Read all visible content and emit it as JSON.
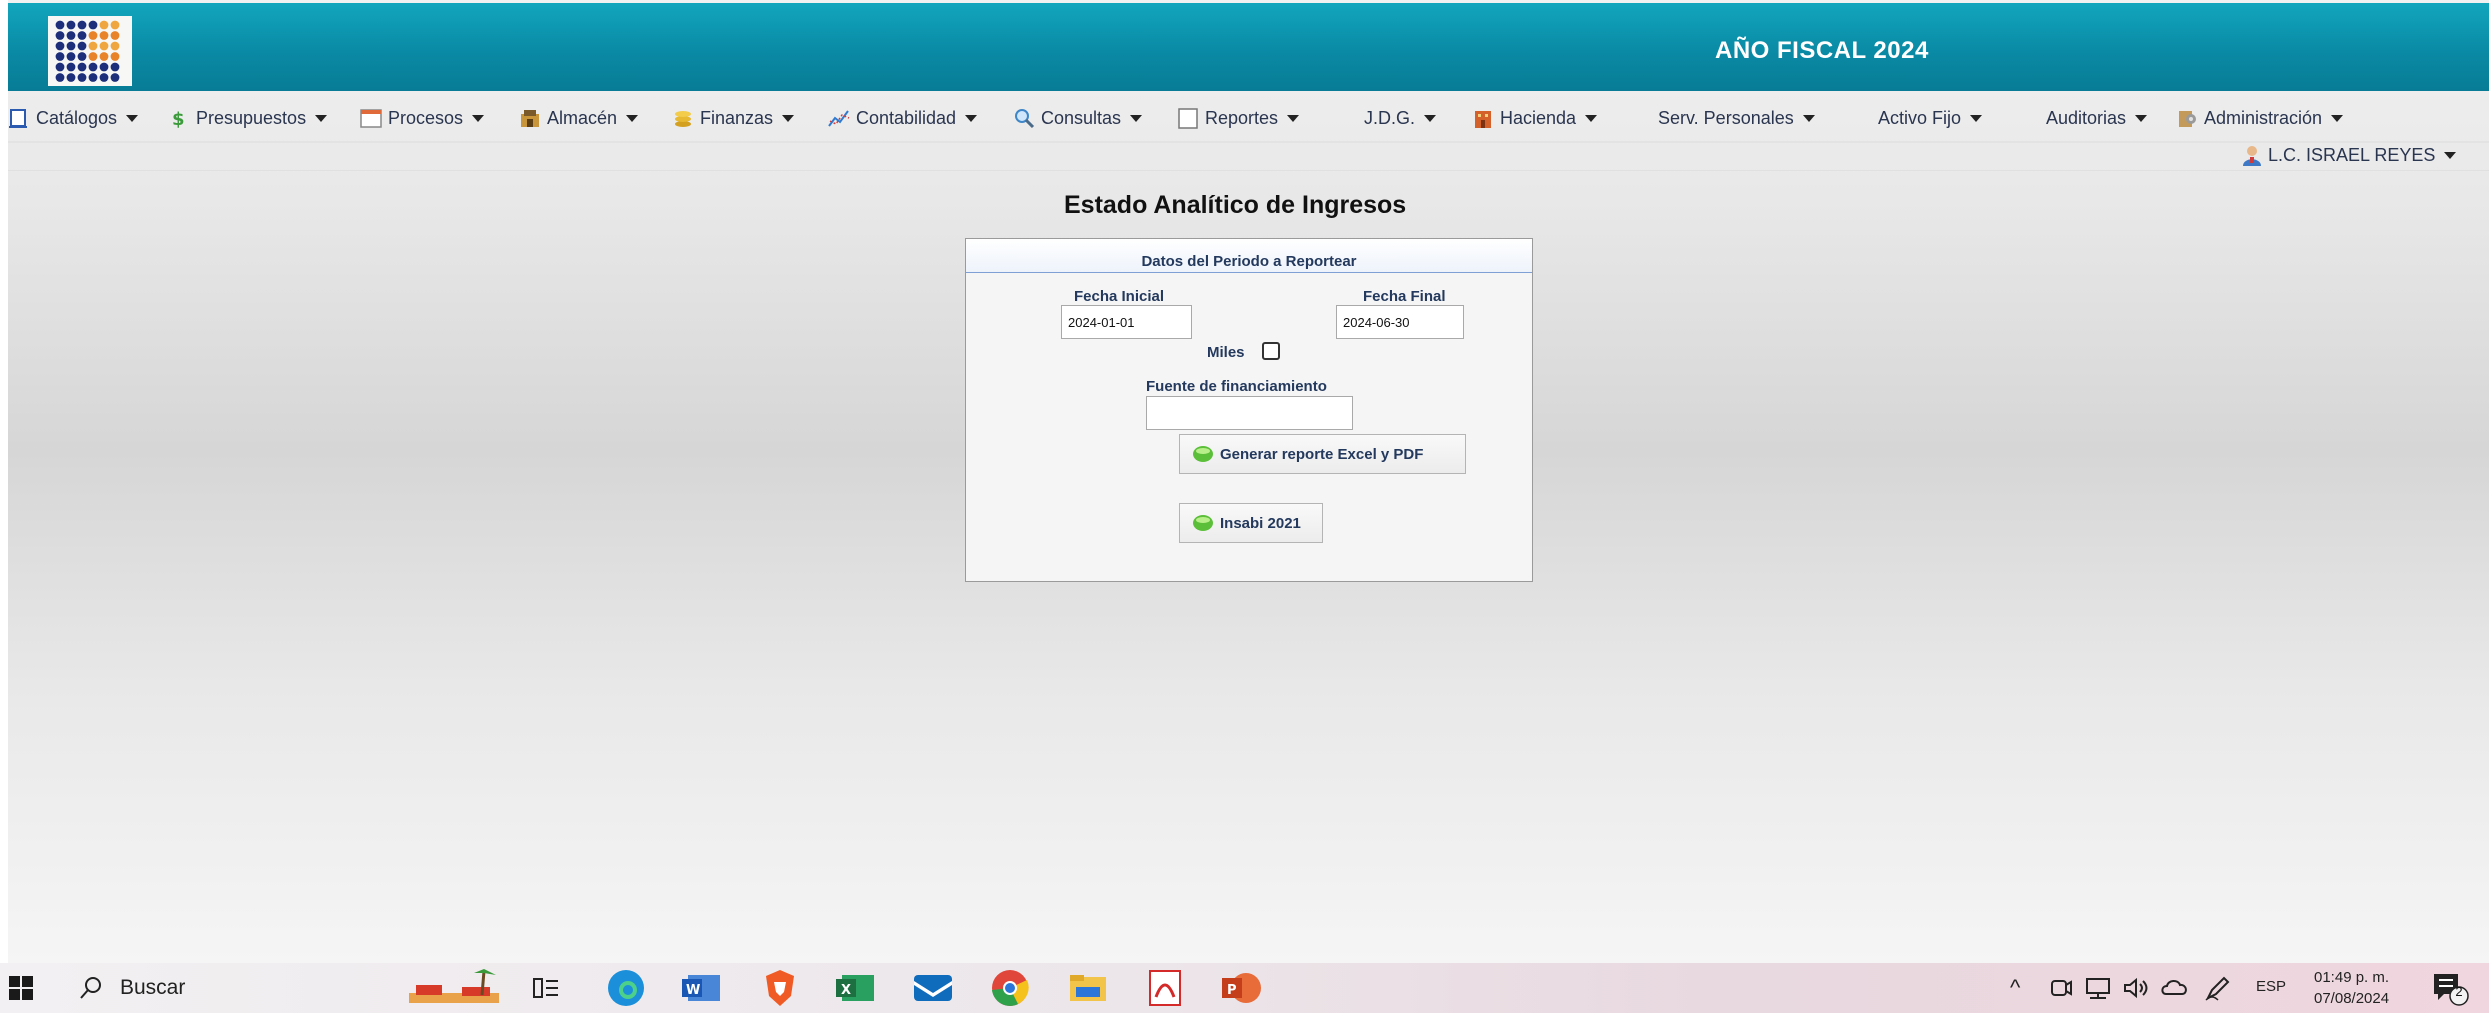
{
  "header": {
    "fiscal_year": "AÑO FISCAL  2024"
  },
  "menu": {
    "catalogos": "Catálogos",
    "presupuestos": "Presupuestos",
    "procesos": "Procesos",
    "almacen": "Almacén",
    "finanzas": "Finanzas",
    "contabilidad": "Contabilidad",
    "consultas": "Consultas",
    "reportes": "Reportes",
    "jdg": "J.D.G.",
    "hacienda": "Hacienda",
    "serv_personales": "Serv. Personales",
    "activo_fijo": "Activo Fijo",
    "auditorias": "Auditorias",
    "administracion": "Administración"
  },
  "user": {
    "name": "L.C. ISRAEL REYES"
  },
  "page": {
    "title": "Estado Analítico de Ingresos"
  },
  "form": {
    "panel_title": "Datos del Periodo a Reportear",
    "fecha_inicial_label": "Fecha Inicial",
    "fecha_inicial_value": "2024-01-01",
    "fecha_final_label": "Fecha Final",
    "fecha_final_value": "2024-06-30",
    "miles_label": "Miles",
    "fuente_label": "Fuente de financiamiento",
    "fuente_value": "",
    "generar_button": "Generar reporte Excel y PDF",
    "insabi_button": "Insabi 2021"
  },
  "taskbar": {
    "search_placeholder": "Buscar",
    "language": "ESP",
    "time": "01:49 p. m.",
    "date": "07/08/2024",
    "notifications": "2"
  },
  "colors": {
    "header_top": "#12a6bd",
    "header_bottom": "#087c96",
    "menu_text": "#2a3550",
    "form_label": "#23395d"
  }
}
